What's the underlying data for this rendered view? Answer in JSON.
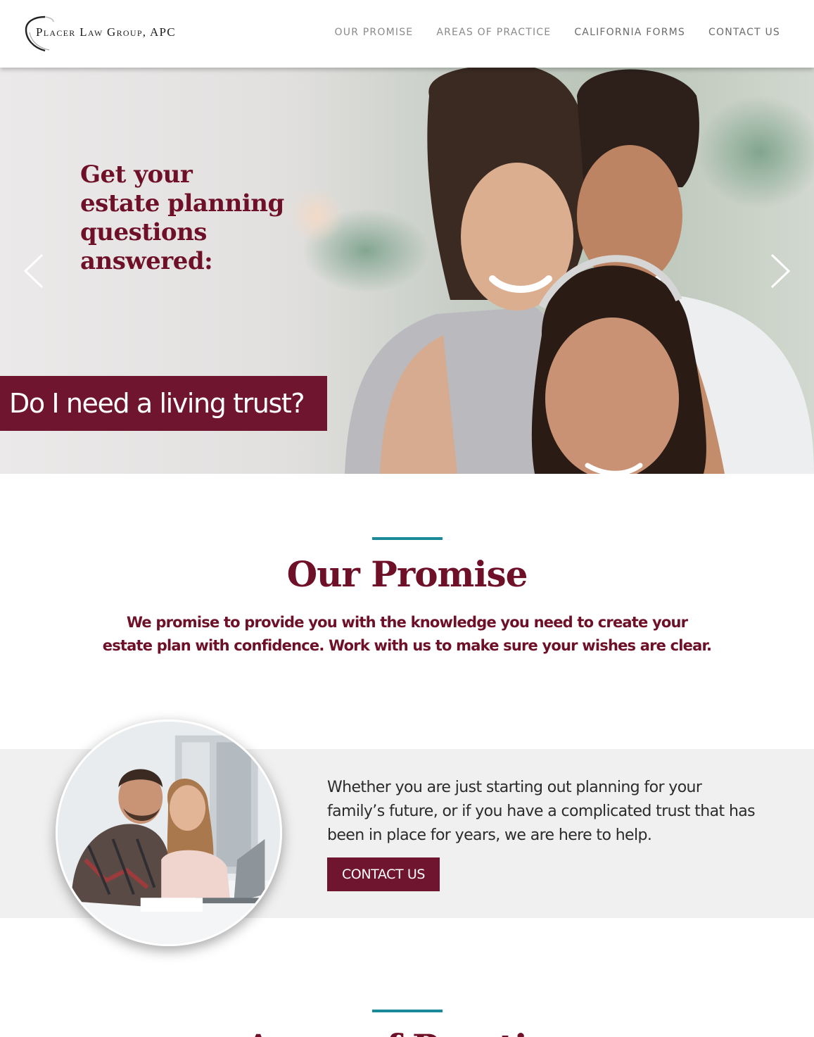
{
  "header": {
    "logo_text": "Placer Law Group, APC",
    "nav": [
      {
        "label": "OUR PROMISE"
      },
      {
        "label": "AREAS OF PRACTICE"
      },
      {
        "label": "CALIFORNIA FORMS"
      },
      {
        "label": "CONTACT US"
      }
    ]
  },
  "hero": {
    "heading_lines": [
      "Get your",
      "estate planning",
      "questions",
      "answered:"
    ],
    "question": "Do I need a living trust?",
    "prev_icon": "chevron-left-icon",
    "next_icon": "chevron-right-icon"
  },
  "promise": {
    "title": "Our Promise",
    "text_lines": [
      "We promise to provide you with the knowledge you need to create your",
      "estate plan with confidence. Work with us to make sure your wishes are clear."
    ]
  },
  "help": {
    "text_lines": [
      "Whether you are just starting out planning for your",
      "family’s future, or if you have a complicated trust that has",
      "been in place for years, we are here to help."
    ],
    "button_label": "CONTACT US"
  },
  "areas": {
    "title": "Areas of Practice"
  },
  "colors": {
    "brand": "#6e1028",
    "accent": "#1a8a99",
    "band": "#f0f0f0"
  }
}
